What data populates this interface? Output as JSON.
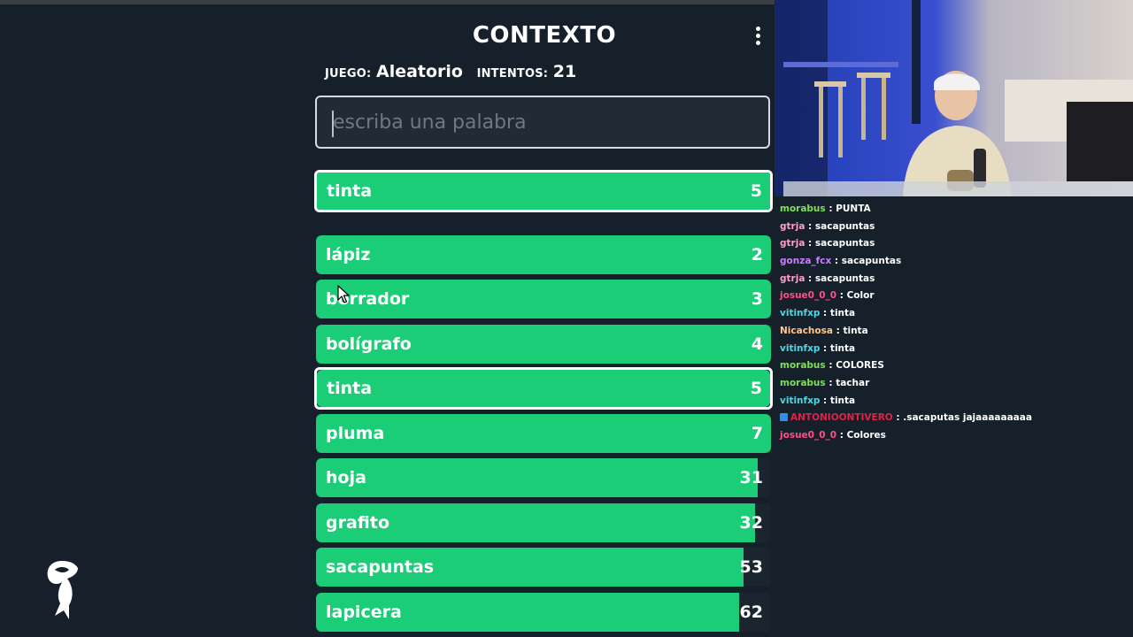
{
  "game": {
    "title": "CONTEXTO",
    "game_label": "JUEGO:",
    "game_value": "Aleatorio",
    "attempts_label": "INTENTOS:",
    "attempts_value": "21",
    "search_placeholder": "escriba una palabra",
    "bar_color": "#1ccd77",
    "last_guess": {
      "word": "tinta",
      "distance": "5",
      "fill": 1.0
    },
    "guesses": [
      {
        "word": "lápiz",
        "distance": "2",
        "fill": 1.0
      },
      {
        "word": "borrador",
        "distance": "3",
        "fill": 1.0
      },
      {
        "word": "bolígrafo",
        "distance": "4",
        "fill": 1.0
      },
      {
        "word": "tinta",
        "distance": "5",
        "fill": 1.0
      },
      {
        "word": "pluma",
        "distance": "7",
        "fill": 1.0
      },
      {
        "word": "hoja",
        "distance": "31",
        "fill": 0.97
      },
      {
        "word": "grafito",
        "distance": "32",
        "fill": 0.965
      },
      {
        "word": "sacapuntas",
        "distance": "53",
        "fill": 0.94
      },
      {
        "word": "lapicera",
        "distance": "62",
        "fill": 0.93
      }
    ]
  },
  "chat": {
    "messages": [
      {
        "user": "morabus",
        "color": "#7fe05a",
        "text": "PUNTA"
      },
      {
        "user": "gtrja",
        "color": "#ff9ec8",
        "text": "sacapuntas"
      },
      {
        "user": "gtrja",
        "color": "#ff9ec8",
        "text": "sacapuntas"
      },
      {
        "user": "gonza_fcx",
        "color": "#c77dff",
        "text": "sacapuntas"
      },
      {
        "user": "gtrja",
        "color": "#ff9ec8",
        "text": "sacapuntas"
      },
      {
        "user": "josue0_0_0",
        "color": "#ff4f8b",
        "text": "Color"
      },
      {
        "user": "vitinfxp",
        "color": "#4fd7e0",
        "text": "tinta"
      },
      {
        "user": "Nicachosa",
        "color": "#ffc58a",
        "text": "tinta"
      },
      {
        "user": "vitinfxp",
        "color": "#4fd7e0",
        "text": "tinta"
      },
      {
        "user": "morabus",
        "color": "#7fe05a",
        "text": "COLORES"
      },
      {
        "user": "morabus",
        "color": "#7fe05a",
        "text": "tachar"
      },
      {
        "user": "vitinfxp",
        "color": "#4fd7e0",
        "text": "tinta"
      },
      {
        "user": "ANTONIOONTIVERO",
        "color": "#e0224a",
        "text": ".sacaputas jajaaaaaaaaa",
        "badge": true
      },
      {
        "user": "josue0_0_0",
        "color": "#ff4f8b",
        "text": "Colores"
      }
    ]
  }
}
